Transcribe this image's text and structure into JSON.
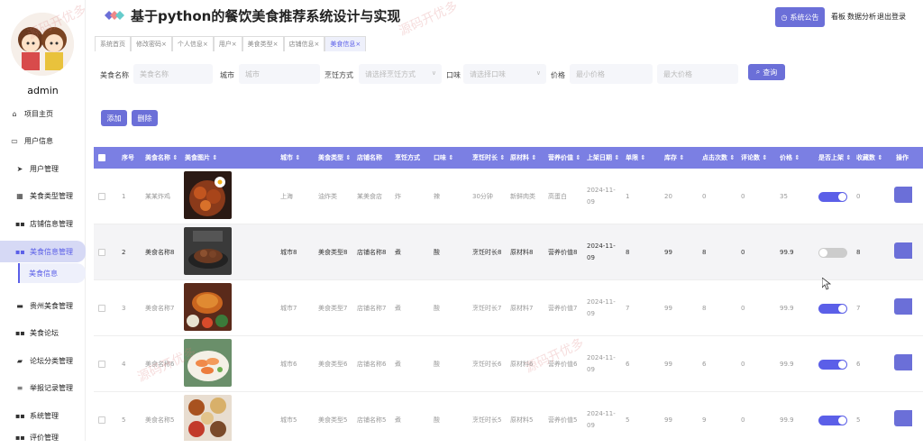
{
  "sidebar": {
    "username": "admin",
    "items": [
      {
        "label": "项目主页",
        "icon": "home-icon"
      },
      {
        "label": "用户信息",
        "icon": "user-info-icon"
      },
      {
        "label": "用户管理",
        "icon": "send-icon"
      },
      {
        "label": "美食类型管理",
        "icon": "chart-icon"
      },
      {
        "label": "店铺信息管理",
        "icon": "grid-icon"
      },
      {
        "label": "美食信息管理",
        "icon": "grid-icon"
      },
      {
        "label": "贵州美食管理",
        "icon": "chat-icon"
      },
      {
        "label": "美食论坛",
        "icon": "grid-icon"
      },
      {
        "label": "论坛分类管理",
        "icon": "briefcase-icon"
      },
      {
        "label": "举报记录管理",
        "icon": "list-icon"
      },
      {
        "label": "系统管理",
        "icon": "grid-icon"
      },
      {
        "label": "评价管理",
        "icon": "grid-icon"
      }
    ],
    "submenu_label": "美食信息"
  },
  "header": {
    "title": "基于python的餐饮美食推荐系统设计与实现",
    "notice_button": "系统公告",
    "links": [
      "看板",
      "数据分析",
      "退出登录"
    ]
  },
  "tabs": [
    "系统首页",
    "修改密码",
    "个人信息",
    "用户",
    "美食类型",
    "店铺信息",
    "美食信息"
  ],
  "active_tab": "美食信息",
  "search": {
    "name_label": "美食名称",
    "name_placeholder": "美食名称",
    "city_label": "城市",
    "city_placeholder": "城市",
    "cook_label": "烹饪方式",
    "cook_placeholder": "请选择烹饪方式",
    "taste_label": "口味",
    "taste_placeholder": "请选择口味",
    "price_label": "价格",
    "min_price_placeholder": "最小价格",
    "max_price_placeholder": "最大价格",
    "query_button": "查询"
  },
  "actions": {
    "add": "添加",
    "delete": "删除"
  },
  "table": {
    "headers": [
      "序号",
      "美食名称",
      "美食图片",
      "城市",
      "美食类型",
      "店铺名称",
      "烹饪方式",
      "口味",
      "烹饪时长",
      "原材料",
      "营养价值",
      "上架日期",
      "单限",
      "库存",
      "点击次数",
      "评论数",
      "价格",
      "是否上架",
      "收藏数",
      "操作"
    ],
    "rows": [
      {
        "no": "1",
        "name": "某某炸鸡",
        "city": "上海",
        "type": "油炸类",
        "shop": "某美食店",
        "cook": "炸",
        "taste": "辣",
        "time": "30分钟",
        "material": "新鲜肉类",
        "nutrition": "高蛋白",
        "date": "2024-11-09",
        "limit": "1",
        "stock": "20",
        "clicks": "0",
        "comments": "0",
        "price": "35",
        "on_shelf": true,
        "favorites": "0"
      },
      {
        "no": "2",
        "name": "美食名称8",
        "city": "城市8",
        "type": "美食类型8",
        "shop": "店铺名称8",
        "cook": "煮",
        "taste": "酸",
        "time": "烹饪时长8",
        "material": "原材料8",
        "nutrition": "营养价值8",
        "date": "2024-11-09",
        "limit": "8",
        "stock": "99",
        "clicks": "8",
        "comments": "0",
        "price": "99.9",
        "on_shelf": false,
        "favorites": "8"
      },
      {
        "no": "3",
        "name": "美食名称7",
        "city": "城市7",
        "type": "美食类型7",
        "shop": "店铺名称7",
        "cook": "煮",
        "taste": "酸",
        "time": "烹饪时长7",
        "material": "原材料7",
        "nutrition": "营养价值7",
        "date": "2024-11-09",
        "limit": "7",
        "stock": "99",
        "clicks": "8",
        "comments": "0",
        "price": "99.9",
        "on_shelf": true,
        "favorites": "7"
      },
      {
        "no": "4",
        "name": "美食名称6",
        "city": "城市6",
        "type": "美食类型6",
        "shop": "店铺名称6",
        "cook": "煮",
        "taste": "酸",
        "time": "烹饪时长6",
        "material": "原材料6",
        "nutrition": "营养价值6",
        "date": "2024-11-09",
        "limit": "6",
        "stock": "99",
        "clicks": "6",
        "comments": "0",
        "price": "99.9",
        "on_shelf": true,
        "favorites": "6"
      },
      {
        "no": "5",
        "name": "美食名称5",
        "city": "城市5",
        "type": "美食类型5",
        "shop": "店铺名称5",
        "cook": "煮",
        "taste": "酸",
        "time": "烹饪时长5",
        "material": "原材料5",
        "nutrition": "营养价值5",
        "date": "2024-11-09",
        "limit": "5",
        "stock": "99",
        "clicks": "9",
        "comments": "0",
        "price": "99.9",
        "on_shelf": true,
        "favorites": "5"
      }
    ]
  },
  "watermark_text": "源码开优多",
  "colors": {
    "accent": "#6b6fd8",
    "header_row": "#7b7fe3",
    "active_menu_bg": "#d6d9f5"
  }
}
